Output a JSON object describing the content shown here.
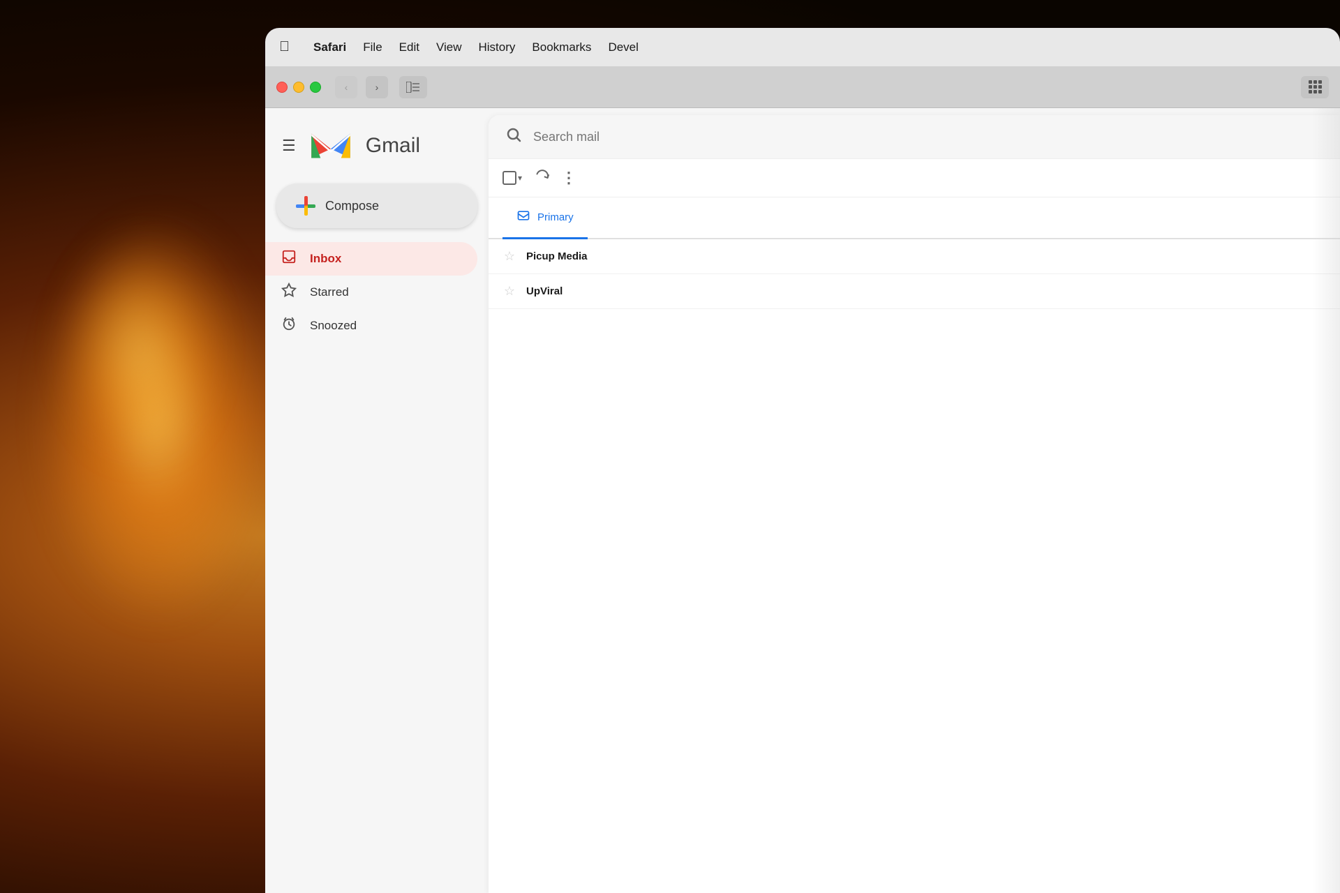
{
  "background": {
    "color": "#1a0800"
  },
  "menubar": {
    "apple_symbol": "",
    "items": [
      {
        "id": "safari",
        "label": "Safari",
        "active": true
      },
      {
        "id": "file",
        "label": "File",
        "active": false
      },
      {
        "id": "edit",
        "label": "Edit",
        "active": false
      },
      {
        "id": "view",
        "label": "View",
        "active": false
      },
      {
        "id": "history",
        "label": "History",
        "active": false
      },
      {
        "id": "bookmarks",
        "label": "Bookmarks",
        "active": false
      },
      {
        "id": "develop",
        "label": "Devel",
        "active": false
      }
    ]
  },
  "browser": {
    "back_button": "‹",
    "forward_button": "›",
    "sidebar_icon": "⬜",
    "grid_icon": "grid"
  },
  "gmail": {
    "hamburger_label": "☰",
    "logo_text": "Gmail",
    "compose_label": "Compose",
    "search_placeholder": "Search mail",
    "nav_items": [
      {
        "id": "inbox",
        "label": "Inbox",
        "icon": "🔖",
        "active": true
      },
      {
        "id": "starred",
        "label": "Starred",
        "icon": "★",
        "active": false
      },
      {
        "id": "snoozed",
        "label": "Snoozed",
        "icon": "🕐",
        "active": false
      }
    ],
    "toolbar": {
      "select_label": "",
      "refresh_label": "↻",
      "more_label": "⋮"
    },
    "tabs": [
      {
        "id": "primary",
        "label": "Primary",
        "icon": "⬜",
        "active": true
      }
    ],
    "emails": [
      {
        "id": 1,
        "sender": "Picup Media",
        "starred": false
      },
      {
        "id": 2,
        "sender": "UpViral",
        "starred": false
      }
    ]
  }
}
